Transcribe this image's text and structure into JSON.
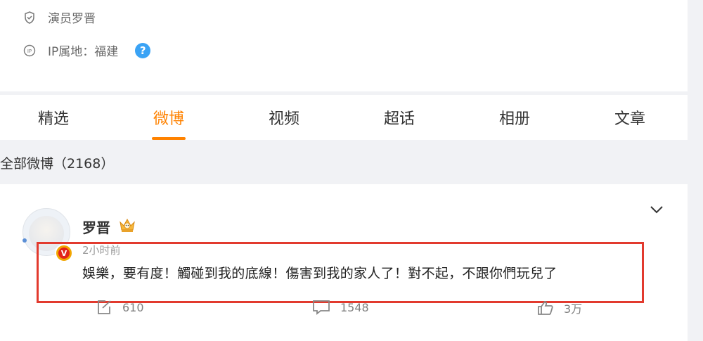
{
  "profile": {
    "title_label": "演员罗晋",
    "ip_location": "IP属地：福建",
    "help_glyph": "?"
  },
  "tabs": [
    {
      "label": "精选",
      "active": false
    },
    {
      "label": "微博",
      "active": true
    },
    {
      "label": "视频",
      "active": false
    },
    {
      "label": "超话",
      "active": false
    },
    {
      "label": "相册",
      "active": false
    },
    {
      "label": "文章",
      "active": false
    }
  ],
  "feed": {
    "all_label": "全部微博（2168）"
  },
  "post": {
    "username": "罗晋",
    "timestamp": "2小时前",
    "text": "娛樂，要有度！觸碰到我的底線！傷害到我的家人了！對不起，不跟你們玩兒了",
    "verify_glyph": "V",
    "reposts": "610",
    "comments": "1548",
    "likes": "3万"
  },
  "colors": {
    "accent": "#ff8200",
    "highlight_box": "#e23a2e",
    "help_icon": "#3aa3f5"
  },
  "icons": [
    "shield-icon",
    "ip-icon",
    "help-icon",
    "crown-icon",
    "chevron-down-icon",
    "repost-icon",
    "comment-icon",
    "like-icon"
  ]
}
